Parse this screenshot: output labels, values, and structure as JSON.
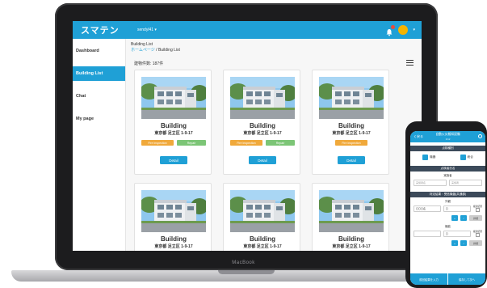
{
  "laptop": {
    "brand": "MacBook"
  },
  "app": {
    "logo": "スマテン",
    "user_menu": "sendyl41 ▾",
    "colors": {
      "primary": "#1fa0d6",
      "tag_orange": "#f0a93b",
      "tag_green": "#7cc576",
      "notification": "#e74c3c"
    }
  },
  "sidebar": {
    "items": [
      {
        "label": "Dashboard",
        "active": false
      },
      {
        "label": "Building List",
        "active": true
      },
      {
        "label": "Chat",
        "active": false
      },
      {
        "label": "My page",
        "active": false
      }
    ]
  },
  "main": {
    "page_title": "Building List",
    "breadcrumb_home": "ホームページ",
    "breadcrumb_sep": " / ",
    "breadcrumb_current": "Building List",
    "count_text": "建物件数: 187件",
    "cards": [
      {
        "name": "Building",
        "address": "東京都 足立区 1-9-17",
        "tags": [
          {
            "label": "Fire inspection",
            "color": "orange"
          },
          {
            "label": "Repair",
            "color": "green"
          }
        ],
        "button": "Detail"
      },
      {
        "name": "Building",
        "address": "東京都 足立区 1-9-17",
        "tags": [
          {
            "label": "Fire inspection",
            "color": "orange"
          },
          {
            "label": "Repair",
            "color": "green"
          }
        ],
        "button": "Detail"
      },
      {
        "name": "Building",
        "address": "東京都 足立区 1-9-17",
        "tags": [
          {
            "label": "Fire inspection",
            "color": "orange"
          }
        ],
        "button": "Detail"
      },
      {
        "name": "Building",
        "address": "東京都 足立区 1-9-17",
        "tags": [],
        "button": ""
      },
      {
        "name": "Building",
        "address": "東京都 足立区 1-9-17",
        "tags": [],
        "button": ""
      },
      {
        "name": "Building",
        "address": "東京都 足立区 1-9-17",
        "tags": [],
        "button": ""
      }
    ]
  },
  "phone": {
    "back": "く戻る",
    "title": "自動火災報知設備",
    "subtitle": "1/12",
    "section1": "点検種別",
    "check1": "機器",
    "check2": "総合",
    "section2": "点検者氏名",
    "field_label": "実施者",
    "field_ph1": "実施者名",
    "field_ph2": "実施者",
    "section3": "判定結果・受信機盤(共通部)",
    "sub_label1": "外観",
    "val1": "〇〇〇名",
    "val1b": "〇",
    "check_label": "検査結果",
    "sub_label2": "機能",
    "val2b": "〇",
    "btn_plus": "+",
    "btn_slash": "/",
    "btn_detail": "詳細",
    "footer_left": "前回結果を入力",
    "footer_right": "保存して次へ"
  }
}
